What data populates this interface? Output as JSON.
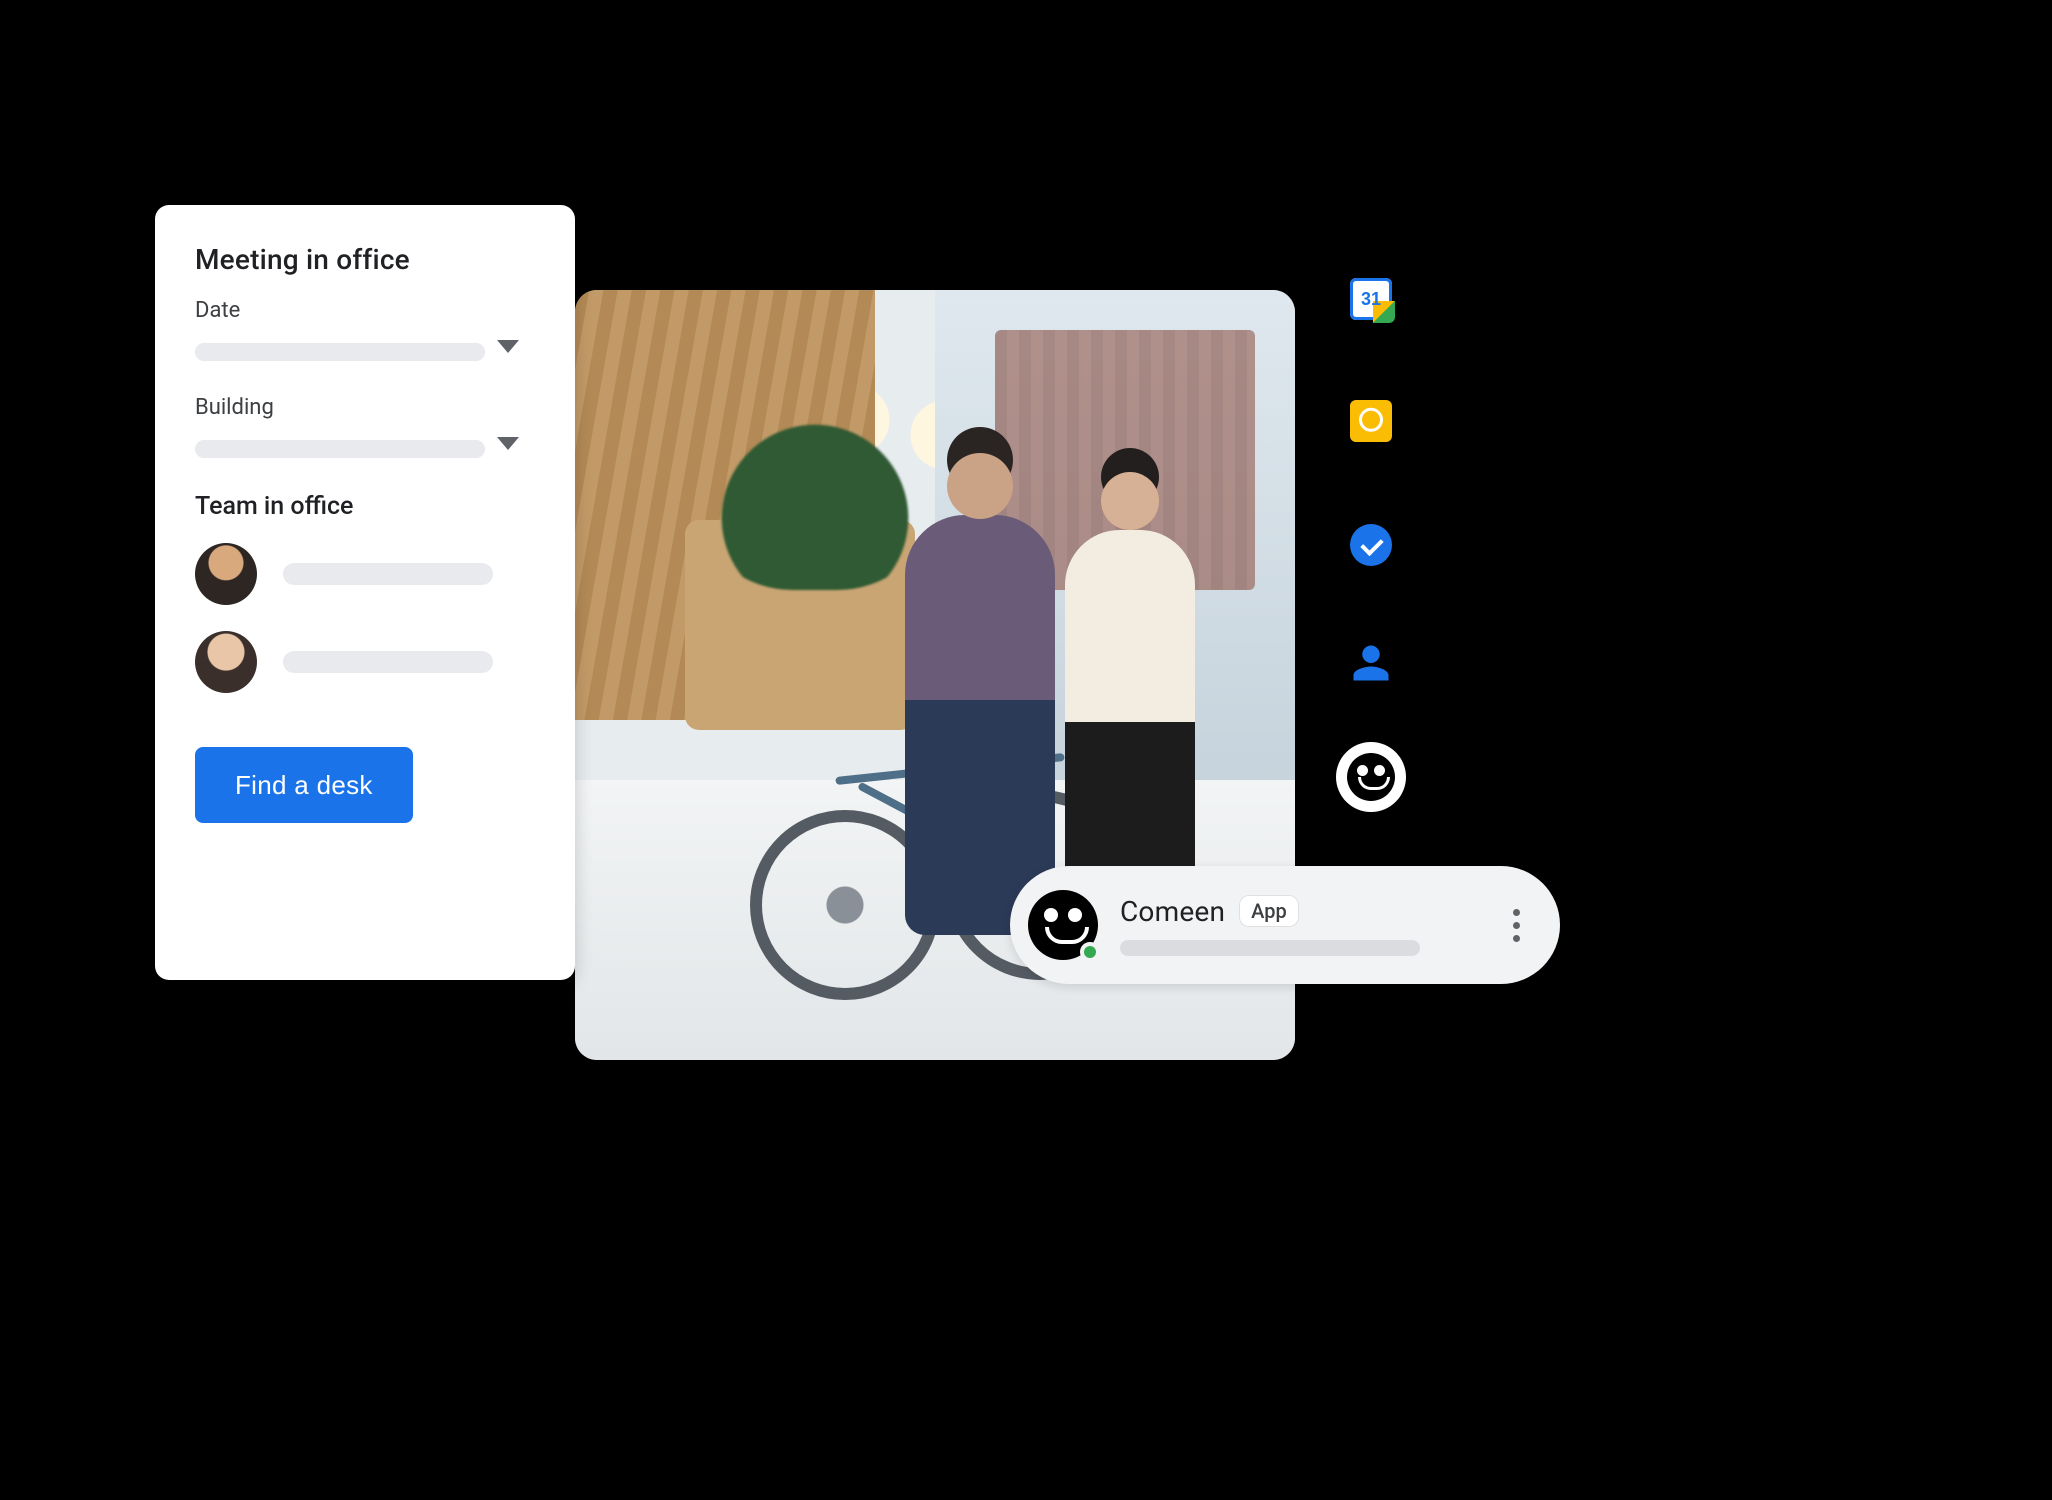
{
  "booking_card": {
    "title": "Meeting in office",
    "date_label": "Date",
    "building_label": "Building",
    "team_section_title": "Team in office",
    "cta_label": "Find a desk"
  },
  "side_panel": {
    "icons": [
      {
        "name": "google-calendar",
        "badge": "31"
      },
      {
        "name": "google-keep"
      },
      {
        "name": "google-tasks"
      },
      {
        "name": "google-contacts"
      },
      {
        "name": "comeen"
      }
    ]
  },
  "chat_chip": {
    "app_name": "Comeen",
    "badge_label": "App",
    "presence": "online"
  },
  "colors": {
    "primary_blue": "#1a73e8",
    "keep_yellow": "#fbbc04",
    "presence_green": "#34a853"
  }
}
